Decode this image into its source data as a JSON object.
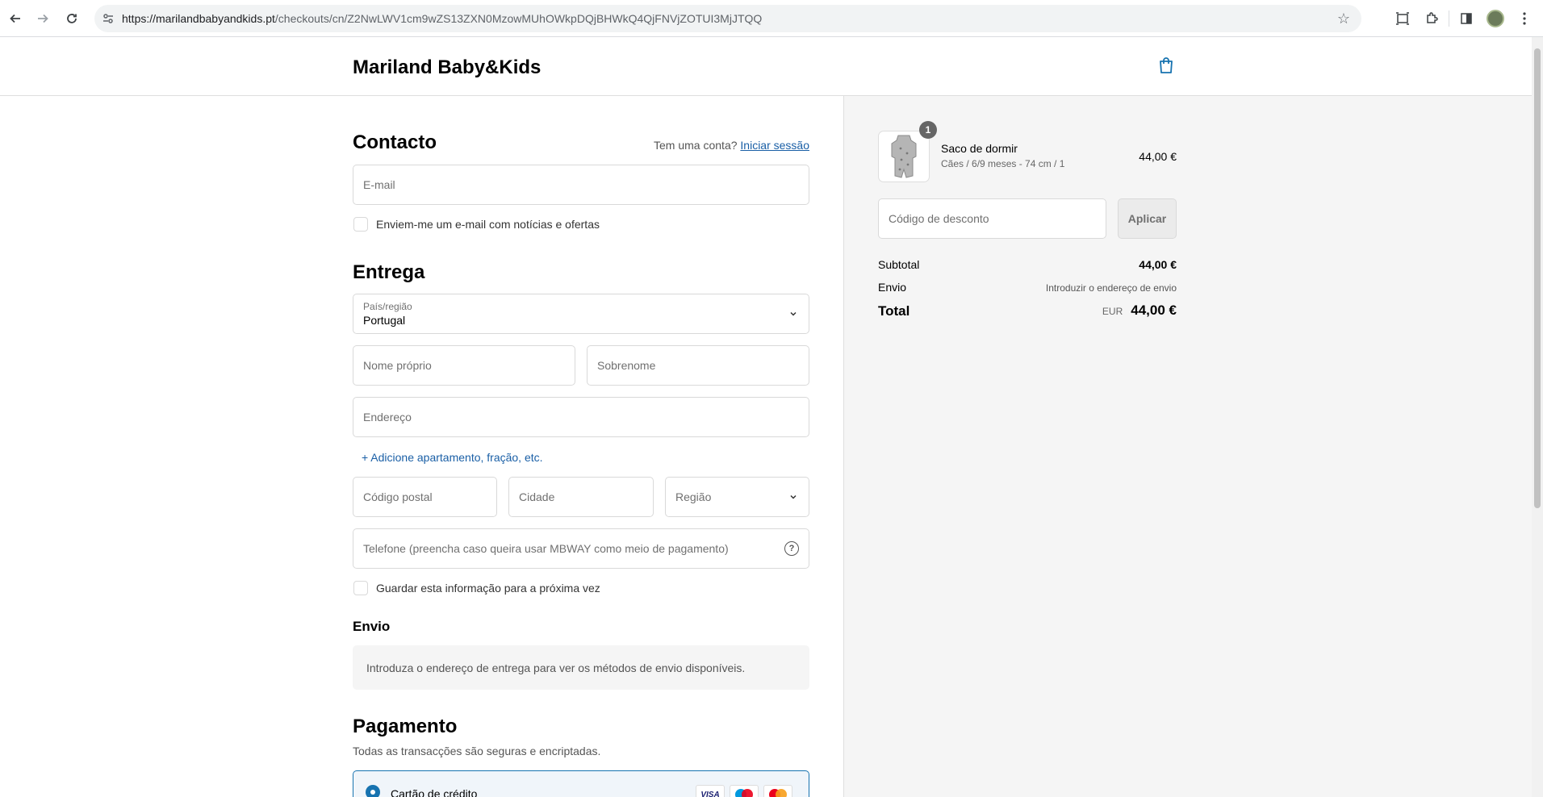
{
  "browser": {
    "url_host": "https://marilandbabyandkids.pt",
    "url_path": "/checkouts/cn/Z2NwLWV1cm9wZS13ZXN0MzowMUhOWkpDQjBHWkQ4QjFNVjZOTUI3MjJTQQ"
  },
  "store": {
    "name": "Mariland Baby&Kids"
  },
  "contact": {
    "heading": "Contacto",
    "account_prompt": "Tem uma conta?",
    "login_link": "Iniciar sessão",
    "email_placeholder": "E-mail",
    "newsletter_label": "Enviem-me um e-mail com notícias e ofertas"
  },
  "delivery": {
    "heading": "Entrega",
    "country_label": "País/região",
    "country_value": "Portugal",
    "first_name_placeholder": "Nome próprio",
    "last_name_placeholder": "Sobrenome",
    "address_placeholder": "Endereço",
    "add_apartment": "+ Adicione apartamento, fração, etc.",
    "postal_placeholder": "Código postal",
    "city_placeholder": "Cidade",
    "region_placeholder": "Região",
    "phone_placeholder": "Telefone (preencha caso queira usar MBWAY como meio de pagamento)",
    "save_info_label": "Guardar esta informação para a próxima vez"
  },
  "shipping": {
    "heading": "Envio",
    "notice": "Introduza o endereço de entrega para ver os métodos de envio disponíveis."
  },
  "payment": {
    "heading": "Pagamento",
    "subtitle": "Todas as transacções são seguras e encriptadas.",
    "method_label": "Cartão de crédito",
    "card_visa": "VISA"
  },
  "summary": {
    "item": {
      "qty": "1",
      "name": "Saco de dormir",
      "variant": "Cães / 6/9 meses - 74 cm / 1",
      "price": "44,00 €"
    },
    "discount_placeholder": "Código de desconto",
    "apply_label": "Aplicar",
    "subtotal_label": "Subtotal",
    "subtotal_value": "44,00 €",
    "shipping_label": "Envio",
    "shipping_value": "Introduzir o endereço de envio",
    "total_label": "Total",
    "currency": "EUR",
    "total_value": "44,00 €"
  },
  "colors": {
    "link": "#1a5fa6",
    "accent": "#1773b0",
    "summary_bg": "#f5f5f5"
  }
}
